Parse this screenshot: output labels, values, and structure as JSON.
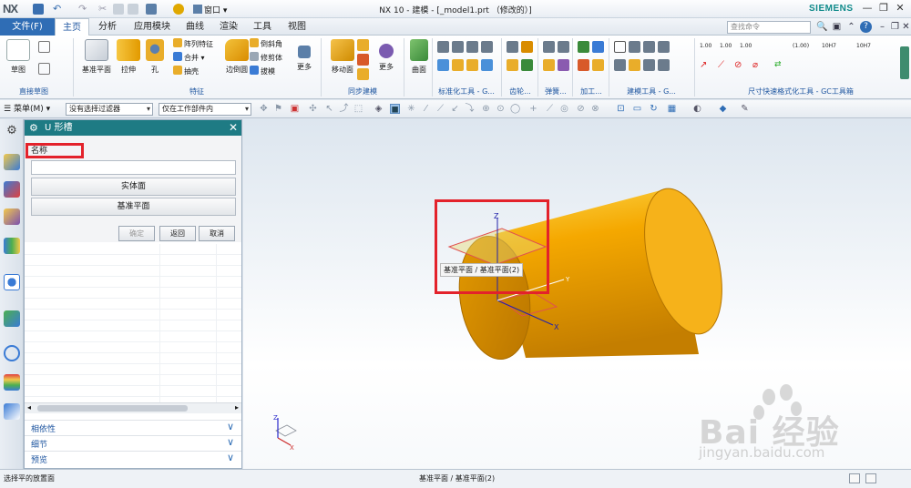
{
  "app": {
    "logo": "NX",
    "title": "NX 10 - 建模 - [_model1.prt （修改的）]",
    "brand": "SIEMENS",
    "window_menu": "窗口"
  },
  "tabs": {
    "file": "文件(F)",
    "items": [
      "主页",
      "分析",
      "应用模块",
      "曲线",
      "渲染",
      "工具",
      "视图"
    ],
    "active_index": 0
  },
  "command_search": {
    "placeholder": "查找命令"
  },
  "ribbon": {
    "sketch": {
      "label": "草图",
      "group": "直接草图"
    },
    "feature": {
      "group": "特征",
      "datum_plane": "基准平面",
      "extrude": "拉伸",
      "hole": "孔",
      "pattern_feature": "阵列特征",
      "unite": "合并",
      "shell": "抽壳",
      "edge_blend": "边倒圆",
      "chamfer": "倒斜角",
      "trim_body": "修剪体",
      "draft": "拔模",
      "more": "更多"
    },
    "sync": {
      "group": "同步建模",
      "move_face": "移动面",
      "more": "更多"
    },
    "surface": {
      "label": "曲面"
    },
    "groups_extra": [
      "标准化工具 - G...",
      "齿轮...",
      "弹簧...",
      "加工...",
      "建模工具 - G...",
      "尺寸快速格式化工具 - GC工具箱"
    ],
    "dim_labels": [
      "1.00",
      "1.00",
      "1.00",
      "(1.00)",
      "10H7",
      "10H7"
    ]
  },
  "selection_bar": {
    "menu": "菜单(M)",
    "filter": "没有选择过滤器",
    "scope": "仅在工作部件内"
  },
  "dialog": {
    "title": "U 形槽",
    "name_label": "名称",
    "name_value": "",
    "solid_face_button": "实体面",
    "datum_plane_button": "基准平面",
    "ok_button": "确定",
    "back_button": "返回",
    "cancel_button": "取消",
    "sections": [
      "相依性",
      "细节",
      "预览"
    ]
  },
  "viewport": {
    "tooltip": "基准平面 / 基准平面(2)",
    "axis_labels": {
      "x": "X",
      "y": "Y",
      "z": "Z"
    },
    "watermark_text": "Bai 经验",
    "watermark_url": "jingyan.baidu.com",
    "colors": {
      "cylinder": "#f5a800",
      "annotation": "#e3222b",
      "datum": "#e05050"
    }
  },
  "status": {
    "left": "选择平的放置面",
    "center": "基准平面 / 基准平面(2)"
  }
}
